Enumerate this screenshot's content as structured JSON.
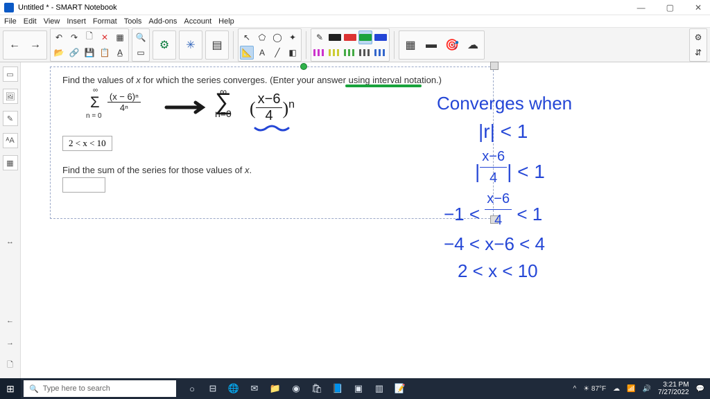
{
  "window": {
    "title": "Untitled * - SMART Notebook"
  },
  "menu": {
    "items": [
      "File",
      "Edit",
      "View",
      "Insert",
      "Format",
      "Tools",
      "Add-ons",
      "Account",
      "Help"
    ]
  },
  "toolbar": {
    "back": "←",
    "fwd": "→",
    "undo": "↶",
    "redo": "↷",
    "new": "🗋",
    "del": "✕",
    "table": "▦",
    "open": "📂",
    "link": "🔗",
    "save": "💾",
    "paste": "📋",
    "textA": "A̲",
    "zoom": "🔍",
    "screen": "▭",
    "gear": "⚙",
    "puzzle": "✳",
    "grid": "▤",
    "arrow": "↖",
    "shape1": "⬠",
    "shape2": "◯",
    "shape3": "✦",
    "ruler": "📐",
    "textT": "A",
    "line": "╱",
    "eraser": "◧",
    "pen": "✎",
    "colorSel": "▦",
    "fill": "▬",
    "eyedrop": "🎯",
    "cloud": "☁",
    "rightA": "⚙",
    "rightB": "⇵"
  },
  "side": {
    "i1": "▭",
    "i2": "🖼",
    "i3": "✎",
    "i4": "ᴬA",
    "i5": "▦",
    "i6": "↔",
    "i7": "←",
    "i8": "→",
    "i9": "🗋"
  },
  "problem": {
    "q1_a": "Find the values of ",
    "q1_x": "x",
    "q1_b": " for which the series converges. (Enter your answer using interval notation.)",
    "sum_low": "n = 0",
    "sum_high": "∞",
    "frac_top": "(x − 6)ⁿ",
    "frac_bot": "4ⁿ",
    "ans1": "2 < x < 10",
    "q2_a": "Find the sum of the series for those values of ",
    "q2_x": "x",
    "q2_b": "."
  },
  "hand": {
    "rewrite_top": "∞",
    "rewrite_sig": "∑",
    "rewrite_low": "n=0",
    "rewrite_frac_t": "x−6",
    "rewrite_frac_b": "4",
    "rewrite_exp": "n",
    "h1": "Converges when",
    "h2": "|r| < 1",
    "h3a": "|",
    "h3t": "x−6",
    "h3b": "4",
    "h3c": "| < 1",
    "h4a": "−1 < ",
    "h4t": "x−6",
    "h4b": "4",
    "h4c": " < 1",
    "h5": "−4 < x−6 < 4",
    "h6": "2 < x < 10"
  },
  "taskbar": {
    "search_placeholder": "Type here to search",
    "weather": "87°F",
    "time": "3:21 PM",
    "date": "7/27/2022"
  },
  "colors": {
    "black": "#1a1a1a",
    "blue": "#2446d6",
    "green": "#19a33c"
  }
}
